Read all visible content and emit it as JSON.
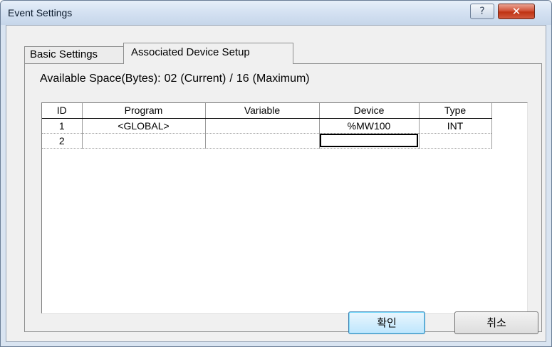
{
  "window": {
    "title": "Event Settings",
    "help_glyph": "?",
    "close_glyph": "✕"
  },
  "tabs": [
    {
      "label": "Basic Settings",
      "active": false
    },
    {
      "label": "Associated Device Setup",
      "active": true
    }
  ],
  "space": {
    "label": "Available Space(Bytes):",
    "current_value": "02",
    "current_label": "(Current)",
    "separator": "/",
    "max_value": "16",
    "max_label": "(Maximum)"
  },
  "grid": {
    "columns": [
      "ID",
      "Program",
      "Variable",
      "Device",
      "Type"
    ],
    "rows": [
      [
        "1",
        "<GLOBAL>",
        "",
        "%MW100",
        "INT"
      ],
      [
        "2",
        "",
        "",
        "",
        ""
      ]
    ],
    "selected_cell": {
      "row": 2,
      "column": "Device"
    }
  },
  "buttons": {
    "ok_label": "확인",
    "cancel_label": "취소"
  },
  "colors": {
    "close_button": "#c7381a",
    "default_button_border": "#3c7fb1",
    "titlebar": "#d5e2f2"
  }
}
